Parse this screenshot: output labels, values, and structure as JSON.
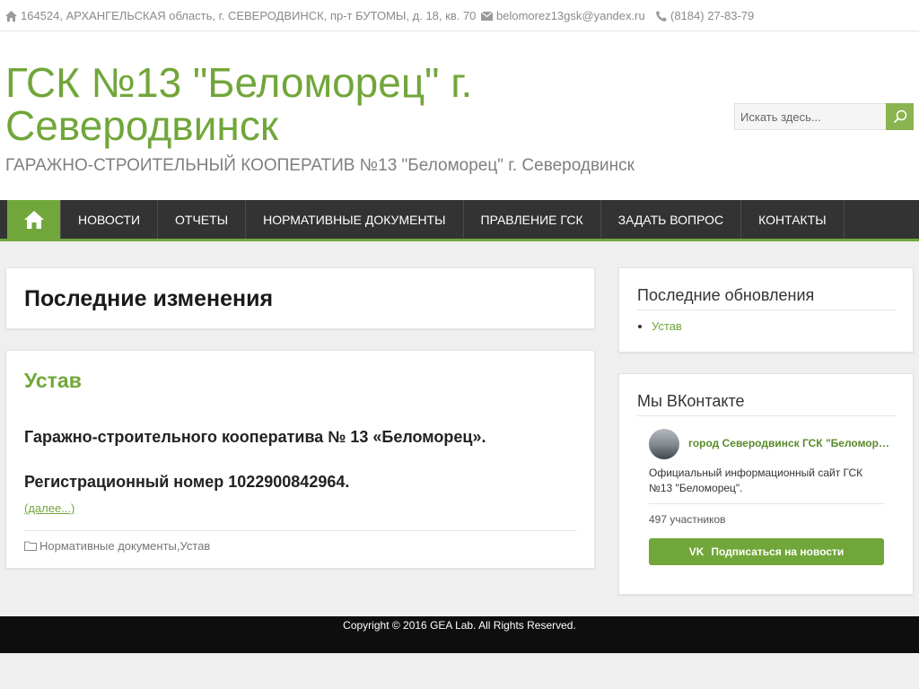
{
  "topbar": {
    "address": "164524, АРХАНГЕЛЬСКАЯ область, г. СЕВЕРОДВИНСК, пр-т БУТОМЫ, д. 18, кв. 70",
    "email": "belomorez13gsk@yandex.ru",
    "phone": "(8184) 27-83-79"
  },
  "header": {
    "title": "ГСК №13 \"Беломорец\" г. Северодвинск",
    "description": "ГАРАЖНО-СТРОИТЕЛЬНЫЙ КООПЕРАТИВ №13 \"Беломорец\" г. Северодвинск",
    "search_placeholder": "Искать здесь..."
  },
  "nav": {
    "items": [
      {
        "label": "НОВОСТИ"
      },
      {
        "label": "ОТЧЕТЫ"
      },
      {
        "label": "НОРМАТИВНЫЕ ДОКУМЕНТЫ"
      },
      {
        "label": "ПРАВЛЕНИЕ ГСК"
      },
      {
        "label": "ЗАДАТЬ ВОПРОС"
      },
      {
        "label": "КОНТАКТЫ"
      }
    ]
  },
  "main": {
    "page_title": "Последние изменения",
    "post": {
      "title": "Устав",
      "line1": "Гаражно-строительного кооператива № 13 «Беломорец».",
      "line2": "Регистрационный номер 1022900842964.",
      "more": "(далее...)",
      "category1": "Нормативные документы",
      "category_sep": ", ",
      "category2": "Устав"
    }
  },
  "sidebar": {
    "recent": {
      "title": "Последние обновления",
      "items": [
        {
          "label": "Устав"
        }
      ]
    },
    "vk": {
      "title": "Мы ВКонтакте",
      "group_name": "город Северодвинск ГСК \"Беломорец\"",
      "description": "Официальный информационный сайт ГСК №13 \"Беломорец\".",
      "members": "497 участников",
      "button": "Подписаться на новости",
      "button_logo": "VK"
    }
  },
  "footer": {
    "copyright": "Copyright © 2016 GEA Lab. All Rights Reserved."
  },
  "colors": {
    "accent": "#71a63a",
    "nav_bg": "#333333",
    "footer_bg": "#0e0e0e"
  },
  "icons": {
    "address": "home-icon",
    "email": "envelope-icon",
    "phone": "phone-icon",
    "search": "search-icon",
    "nav_home": "home-icon",
    "category": "folder-icon"
  }
}
